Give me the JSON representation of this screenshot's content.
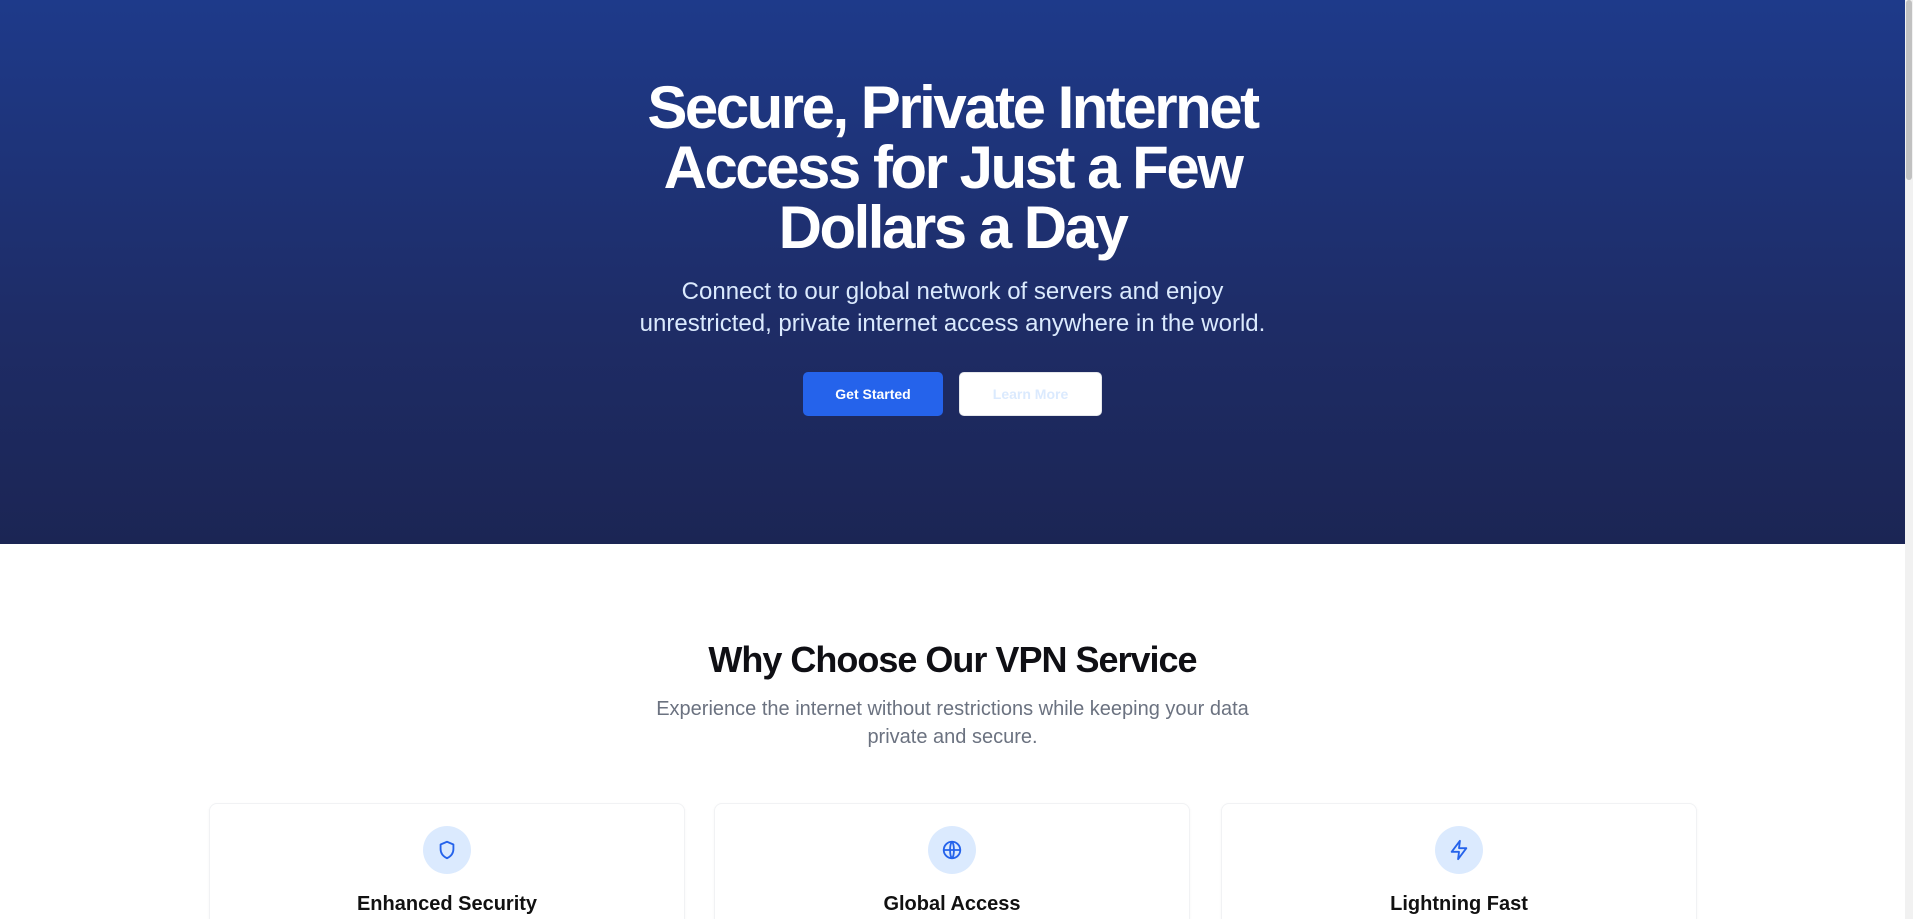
{
  "hero": {
    "title_lines": [
      "Secure, Private Internet",
      "Access for Just a Few",
      "Dollars a Day"
    ],
    "subtitle_lines": [
      "Connect to our global network of servers and enjoy",
      "unrestricted, private internet access anywhere in the world."
    ],
    "primary_button": "Get Started",
    "secondary_button": "Learn More"
  },
  "features": {
    "title": "Why Choose Our VPN Service",
    "subtitle_lines": [
      "Experience the internet without restrictions while keeping your data",
      "private and secure."
    ],
    "cards": [
      {
        "title": "Enhanced Security",
        "icon": "shield-icon"
      },
      {
        "title": "Global Access",
        "icon": "globe-icon"
      },
      {
        "title": "Lightning Fast",
        "icon": "lightning-icon"
      }
    ]
  },
  "colors": {
    "hero_gradient_top": "#1e3a8a",
    "hero_gradient_bottom": "#1b2554",
    "accent": "#2563eb",
    "icon_bg": "#dbeafe"
  }
}
